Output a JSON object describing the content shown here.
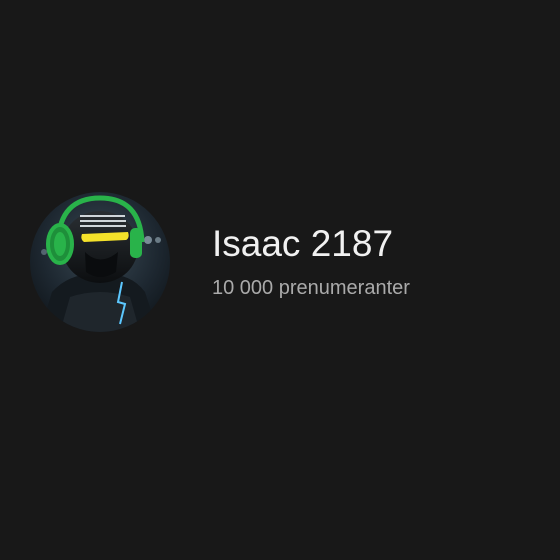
{
  "channel": {
    "name": "Isaac 2187",
    "subscribers": "10 000 prenumeranter",
    "avatar_icon": "avatar-icon"
  },
  "colors": {
    "background": "#181818",
    "name_text": "#f1f1f1",
    "meta_text": "#aaaaaa",
    "headphones_green": "#29b34a",
    "visor_yellow": "#f5e22a"
  }
}
